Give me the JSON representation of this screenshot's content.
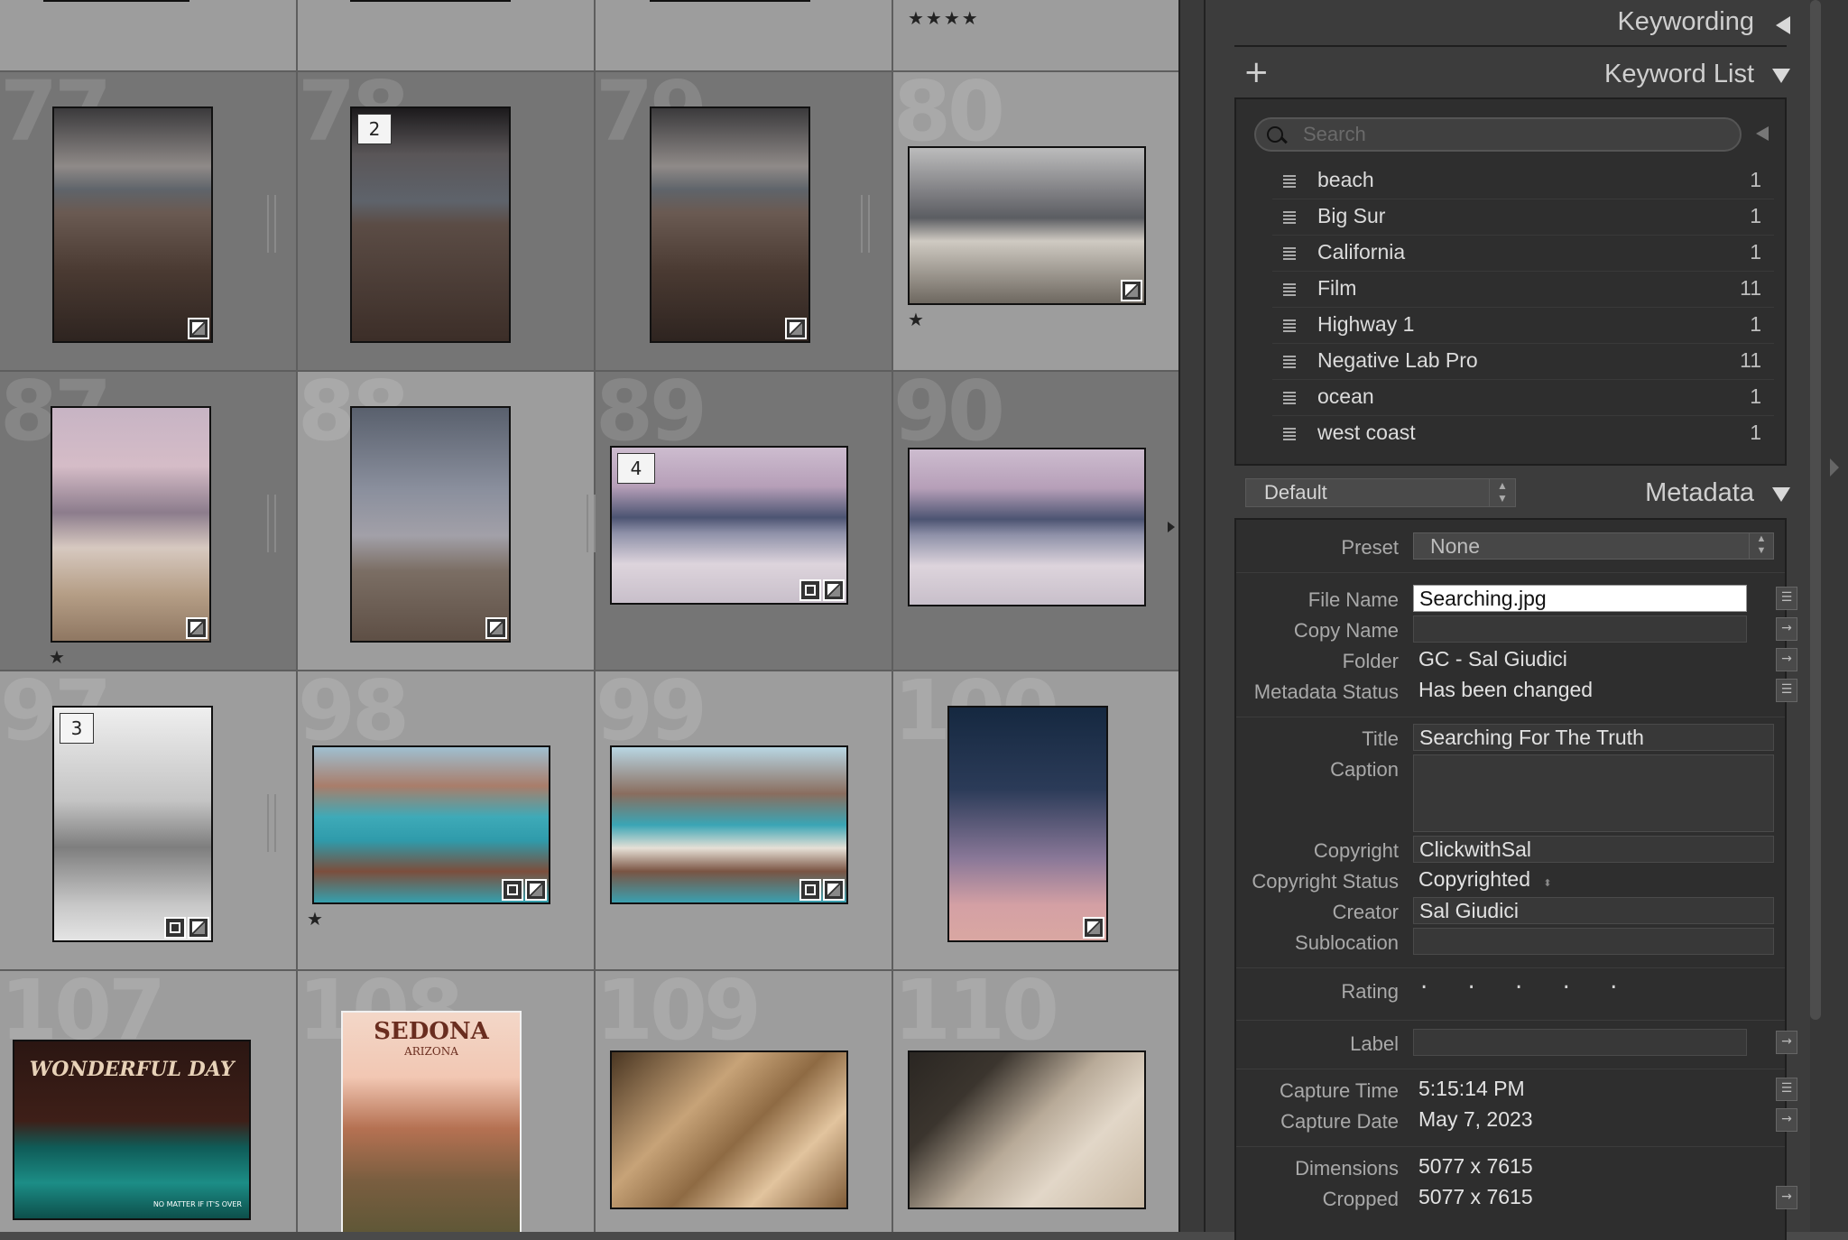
{
  "grid": {
    "top_row": {
      "stars_4": "★★★★"
    },
    "rows": [
      {
        "cells": [
          {
            "num": "77",
            "stars": ""
          },
          {
            "num": "78",
            "badge": "2",
            "stars": ""
          },
          {
            "num": "79",
            "stars": ""
          },
          {
            "num": "80",
            "stars": "★"
          }
        ]
      },
      {
        "cells": [
          {
            "num": "87",
            "stars": "★"
          },
          {
            "num": "88",
            "stars": ""
          },
          {
            "num": "89",
            "badge": "4",
            "stars": ""
          },
          {
            "num": "90",
            "stars": ""
          }
        ]
      },
      {
        "cells": [
          {
            "num": "97",
            "badge": "3",
            "stars": ""
          },
          {
            "num": "98",
            "stars": "★"
          },
          {
            "num": "99",
            "stars": ""
          },
          {
            "num": "100",
            "stars": ""
          }
        ]
      },
      {
        "cells": [
          {
            "num": "107",
            "poster_title": "WONDERFUL DAY",
            "poster_sub": "NO MATTER IF IT'S OVER"
          },
          {
            "num": "108",
            "poster_title": "SEDONA",
            "poster_sub": "ARIZONA"
          },
          {
            "num": "109"
          },
          {
            "num": "110"
          }
        ]
      }
    ]
  },
  "keywording": {
    "header": "Keywording",
    "keyword_list_title": "Keyword List",
    "add_symbol": "+",
    "search_placeholder": "Search",
    "keywords": [
      {
        "name": "beach",
        "count": "1"
      },
      {
        "name": "Big Sur",
        "count": "1"
      },
      {
        "name": "California",
        "count": "1"
      },
      {
        "name": "Film",
        "count": "11"
      },
      {
        "name": "Highway 1",
        "count": "1"
      },
      {
        "name": "Negative Lab Pro",
        "count": "11"
      },
      {
        "name": "ocean",
        "count": "1"
      },
      {
        "name": "west coast",
        "count": "1"
      }
    ]
  },
  "metadata": {
    "title": "Metadata",
    "preset_dropdown": "Default",
    "preset_label": "Preset",
    "preset_value": "None",
    "fields": {
      "file_name_label": "File Name",
      "file_name": "Searching.jpg",
      "copy_name_label": "Copy Name",
      "copy_name": "",
      "folder_label": "Folder",
      "folder": "GC - Sal Giudici",
      "status_label": "Metadata Status",
      "status": "Has been changed",
      "title_label": "Title",
      "title": "Searching For The Truth",
      "caption_label": "Caption",
      "caption": "",
      "copyright_label": "Copyright",
      "copyright": "ClickwithSal",
      "copyright_status_label": "Copyright Status",
      "copyright_status": "Copyrighted",
      "creator_label": "Creator",
      "creator": "Sal Giudici",
      "sublocation_label": "Sublocation",
      "sublocation": "",
      "rating_label": "Rating",
      "rating": ". . . . .",
      "label_label": "Label",
      "label": "",
      "capture_time_label": "Capture Time",
      "capture_time": "5:15:14 PM",
      "capture_date_label": "Capture Date",
      "capture_date": "May 7, 2023",
      "dimensions_label": "Dimensions",
      "dimensions": "5077 x 7615",
      "cropped_label": "Cropped",
      "cropped": "5077 x 7615"
    }
  }
}
